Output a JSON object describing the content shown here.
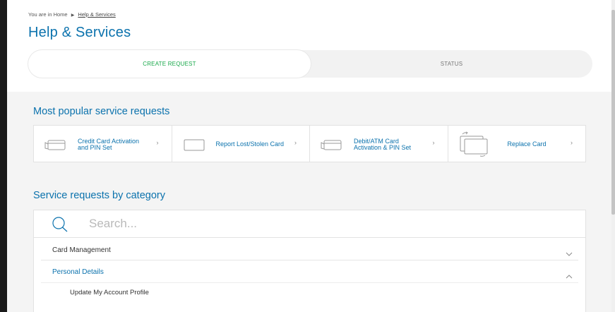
{
  "breadcrumb": {
    "prefix": "You are in Home",
    "separator": "▶",
    "current": "Help & Services"
  },
  "page": {
    "title": "Help & Services"
  },
  "tabs": [
    {
      "label": "CREATE REQUEST",
      "active": true
    },
    {
      "label": "STATUS",
      "active": false
    }
  ],
  "popular": {
    "title": "Most popular service requests",
    "items": [
      {
        "label": "Credit Card Activation and PIN Set",
        "icon": "card-tilted-icon"
      },
      {
        "label": "Report Lost/Stolen Card",
        "icon": "card-icon"
      },
      {
        "label": "Debit/ATM Card Activation & PIN Set",
        "icon": "card-tilted-icon"
      },
      {
        "label": "Replace Card",
        "icon": "card-swap-icon"
      }
    ],
    "chevron": "›"
  },
  "category": {
    "title": "Service requests by category",
    "search_placeholder": "Search...",
    "items": [
      {
        "label": "Card Management",
        "expanded": false
      },
      {
        "label": "Personal Details",
        "expanded": true,
        "children": [
          {
            "label": "Update My Account Profile"
          }
        ]
      }
    ]
  },
  "colors": {
    "brand_blue": "#0b72ad",
    "active_green": "#18a84a",
    "panel_bg": "#f4f4f4"
  }
}
